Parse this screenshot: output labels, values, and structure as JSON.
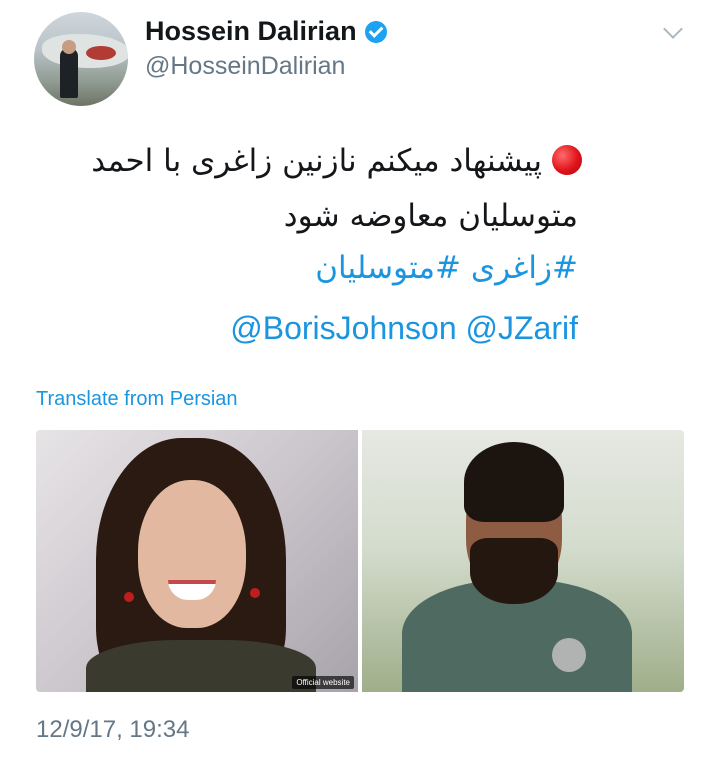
{
  "author": {
    "display_name": "Hossein Dalirian",
    "handle": "@HosseinDalirian",
    "verified": true
  },
  "tweet": {
    "line1": "پیشنهاد میکنم نازنین زاغری با احمد",
    "line2": "متوسلیان معاوضه شود",
    "hashtags": "#زاغری #متوسلیان",
    "mentions": "@BorisJohnson @JZarif",
    "translate_label": "Translate from Persian"
  },
  "media": {
    "watermark": "Official website"
  },
  "timestamp": "12/9/17, 19:34",
  "colors": {
    "link": "#1b95e0",
    "muted": "#657786",
    "verified": "#1da1f2"
  }
}
